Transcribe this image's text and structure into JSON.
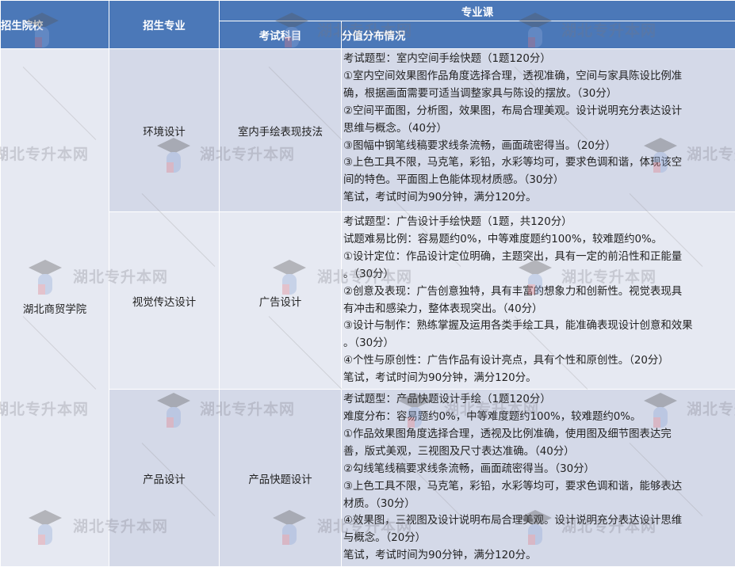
{
  "header": {
    "school_col": "招生院校",
    "major_col": "招生专业",
    "group_col": "专业课",
    "subject_col": "考试科目",
    "distribution_col": "分值分布情况"
  },
  "school": "湖北商贸学院",
  "rows": [
    {
      "major": "环境设计",
      "subject": "室内手绘表现技法",
      "lines": [
        "考试题型：室内空间手绘快题（1题120分）",
        "①室内空间效果图作品角度选择合理，透视准确，空间与家具陈设比例准",
        "确，根据画面需要可适当调整家具与陈设的摆放。（30分）",
        "②空间平面图，分析图，效果图，布局合理美观。设计说明充分表达设计",
        "思维与概念。（40分）",
        "③图幅中钢笔线稿要求线条流畅，画面疏密得当。（20分）",
        "③上色工具不限，马克笔，彩铅，水彩等均可，要求色调和谐，体现该空",
        "间的特色。平面图上色能体现材质感。（30分）",
        "笔试，考试时间为90分钟，满分120分。"
      ]
    },
    {
      "major": "视觉传达设计",
      "subject": "广告设计",
      "lines": [
        "考试题型：广告设计手绘快题（1题，共120分）",
        "试题难易比例：容易题约0%，中等难度题约100%，较难题约0%。",
        "①设计定位：作品设计定位明确，主题突出，具有一定的前沿性和正能量",
        "。（30分）",
        "②创意及表现：广告创意独特，具有丰富的想象力和创新性。视觉表现具",
        "有冲击和感染力，整体表现突出。（40分）",
        "③设计与制作：熟练掌握及运用各类手绘工具，能准确表现设计创意和效果",
        "。（30分）",
        "④个性与原创性：广告作品有设计亮点，具有个性和原创性。（20分）",
        "笔试，考试时间为90分钟，满分120分。"
      ]
    },
    {
      "major": "产品设计",
      "subject": "产品快题设计",
      "lines": [
        "考试题型：产品快题设计手绘（1题120分）",
        "难度分布：容易题约0%，中等难度题约100%，较难题约0%。",
        "①作品效果图角度选择合理，透视及比例准确，使用图及细节图表达完",
        "善，版式美观，三视图及尺寸表达准确。（40分）",
        "②勾线笔线稿要求线条流畅，画面疏密得当。（30分）",
        "③上色工具不限，马克笔，彩铅，水彩等均可，要求色调和谐，能够表达",
        "材质。（30分）",
        "④效果图，三视图及设计说明布局合理美观。设计说明充分表达设计思维",
        "与概念。（20分）",
        "笔试，考试时间为90分钟，满分120分。"
      ]
    }
  ],
  "watermark": "湖北专升本网",
  "colors": {
    "header_bg": "#4b78b8",
    "row_dark": "#d4d9e8",
    "row_light": "#e6e9f2"
  }
}
